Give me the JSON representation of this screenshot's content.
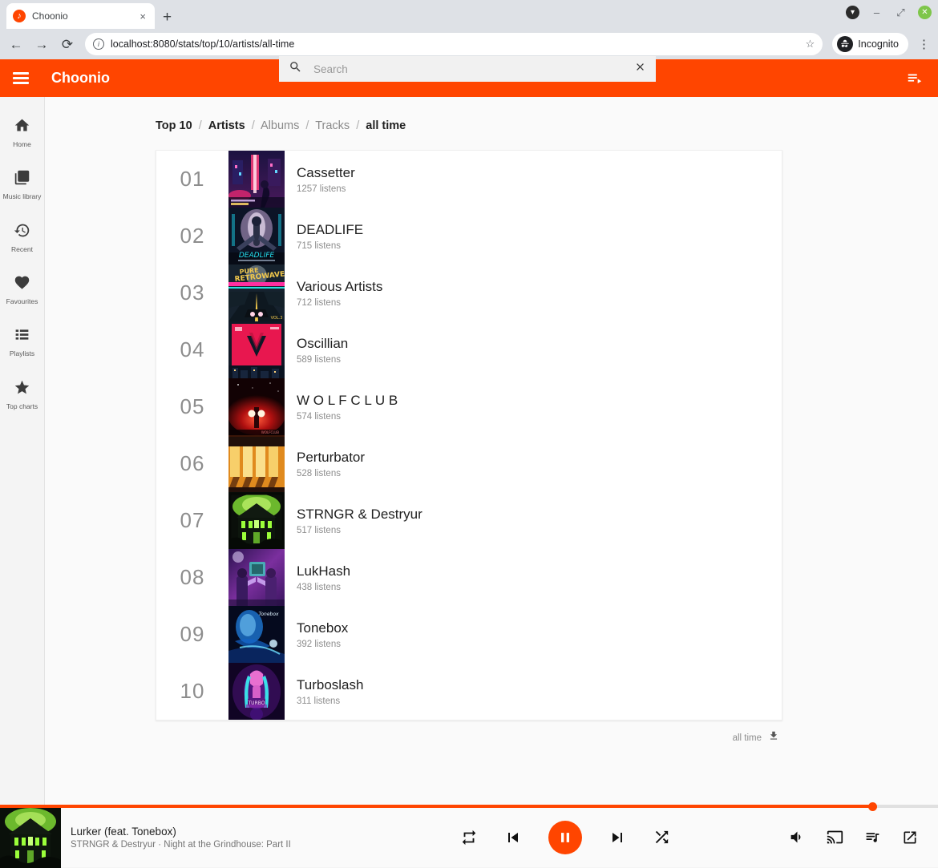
{
  "browser": {
    "tab": {
      "title": "Choonio",
      "favicon": "choonio-icon",
      "close": "×"
    },
    "new_tab": "+",
    "nav": {
      "back": "←",
      "forward": "→",
      "reload": "⟳"
    },
    "url": "localhost:8080/stats/top/10/artists/all-time",
    "star": "☆",
    "incognito_label": "Incognito",
    "menu": "⋮",
    "window": {
      "minimize": "–",
      "maximize": "⤢",
      "close": "✕",
      "dropdown": "▾"
    }
  },
  "app": {
    "title": "Choonio",
    "menu_icon": "hamburger-icon",
    "queue_icon": "queue-play-icon"
  },
  "search": {
    "value": "",
    "placeholder": "Search",
    "clear": "✕"
  },
  "sidebar": {
    "items": [
      {
        "label": "Home",
        "icon": "home-icon"
      },
      {
        "label": "Music library",
        "icon": "library-music-icon"
      },
      {
        "label": "Recent",
        "icon": "history-icon"
      },
      {
        "label": "Favourites",
        "icon": "heart-icon"
      },
      {
        "label": "Playlists",
        "icon": "playlist-icon"
      },
      {
        "label": "Top charts",
        "icon": "star-icon"
      }
    ]
  },
  "breadcrumb": {
    "items": [
      {
        "label": "Top 10",
        "active": true
      },
      {
        "label": "Artists",
        "active": true
      },
      {
        "label": "Albums",
        "active": false
      },
      {
        "label": "Tracks",
        "active": false
      },
      {
        "label": "all time",
        "active": true
      }
    ],
    "separator": "/"
  },
  "chart_data": {
    "type": "table",
    "title": "Top 10 Artists — all time",
    "columns": [
      "rank",
      "artist",
      "listens"
    ],
    "rows": [
      {
        "rank": "01",
        "artist": "Cassetter",
        "listens": "1257 listens",
        "count": 1257,
        "art": "neon-city-street"
      },
      {
        "rank": "02",
        "artist": "DEADLIFE",
        "listens": "715 listens",
        "count": 715,
        "art": "deadlife-figure"
      },
      {
        "rank": "03",
        "artist": "Various Artists",
        "listens": "712 listens",
        "count": 712,
        "art": "pure-retrowave-road"
      },
      {
        "rank": "04",
        "artist": "Oscillian",
        "listens": "589 listens",
        "count": 589,
        "art": "pink-v-emblem"
      },
      {
        "rank": "05",
        "artist": "W O L F C L U B",
        "listens": "574 listens",
        "count": 574,
        "art": "red-fog-silhouette"
      },
      {
        "rank": "06",
        "artist": "Perturbator",
        "listens": "528 listens",
        "count": 528,
        "art": "orange-corridor"
      },
      {
        "rank": "07",
        "artist": "STRNGR & Destryur",
        "listens": "517 listens",
        "count": 517,
        "art": "haunted-house-green"
      },
      {
        "rank": "08",
        "artist": "LukHash",
        "listens": "438 listens",
        "count": 438,
        "art": "purple-two-figures"
      },
      {
        "rank": "09",
        "artist": "Tonebox",
        "listens": "392 listens",
        "count": 392,
        "art": "blue-face-waves"
      },
      {
        "rank": "10",
        "artist": "Turboslash",
        "listens": "311 listens",
        "count": 311,
        "art": "cyan-hair-figure"
      }
    ]
  },
  "card_footer": {
    "label": "all time",
    "download_icon": "download-icon"
  },
  "player": {
    "track_title": "Lurker (feat. Tonebox)",
    "track_subtitle": "STRNGR & Destryur · Night at the Grindhouse: Part II",
    "art": "haunted-house-green",
    "progress_percent": 93,
    "controls": {
      "repeat": "repeat-icon",
      "previous": "skip-previous-icon",
      "play_pause": "pause-icon",
      "next": "skip-next-icon",
      "shuffle": "shuffle-icon"
    },
    "right_controls": {
      "volume": "volume-up-icon",
      "cast": "cast-icon",
      "queue": "queue-music-icon",
      "open": "open-in-new-icon"
    }
  },
  "colors": {
    "accent": "#ff4500",
    "page_bg": "#fafafa",
    "card_bg": "#ffffff",
    "muted_text": "#8d8d8d"
  }
}
